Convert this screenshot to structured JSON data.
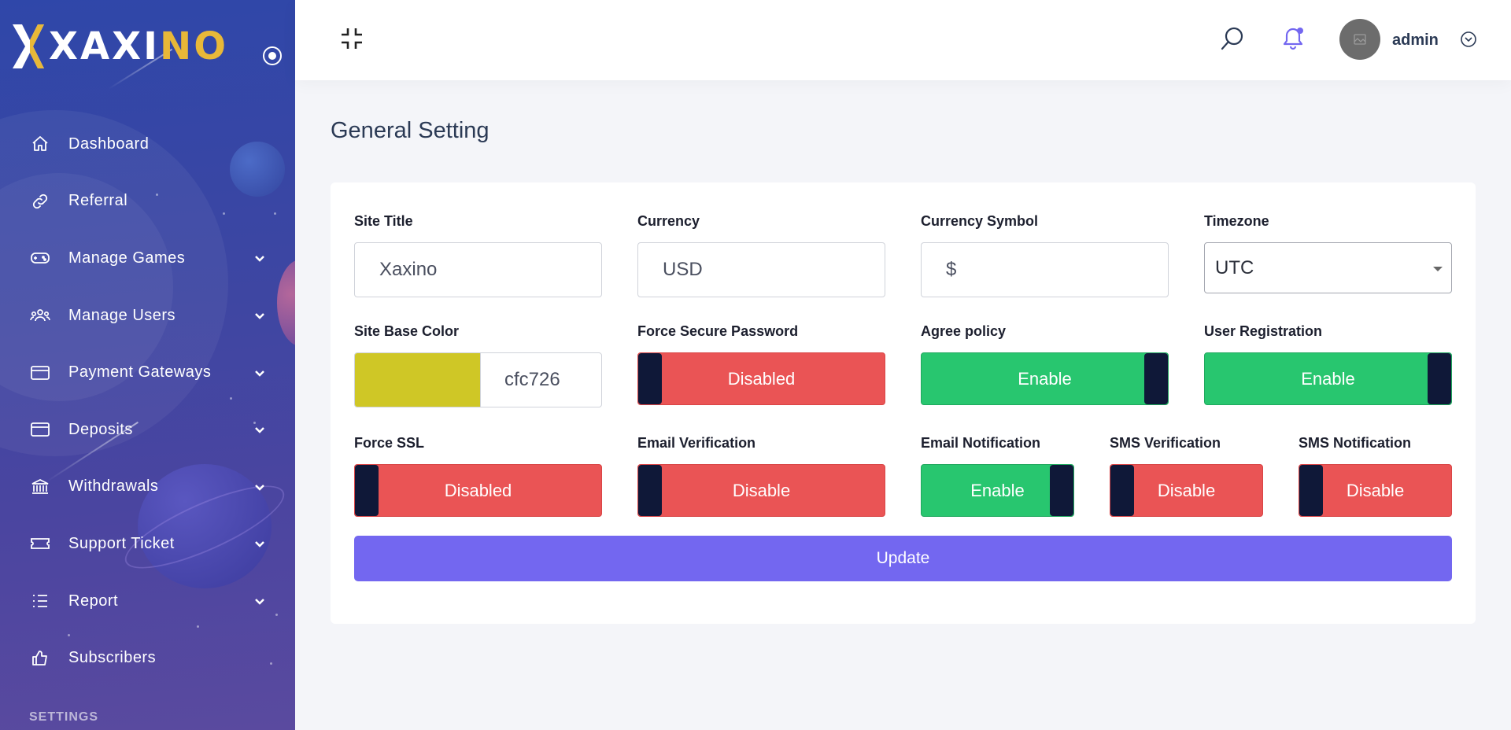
{
  "brand": {
    "name_main": "XAXI",
    "name_accent": "NO"
  },
  "sidebar": {
    "items": [
      {
        "label": "Dashboard",
        "icon": "home-icon",
        "has_submenu": false
      },
      {
        "label": "Referral",
        "icon": "link-icon",
        "has_submenu": false
      },
      {
        "label": "Manage Games",
        "icon": "gamepad-icon",
        "has_submenu": true
      },
      {
        "label": "Manage Users",
        "icon": "users-icon",
        "has_submenu": true
      },
      {
        "label": "Payment Gateways",
        "icon": "credit-card-icon",
        "has_submenu": true
      },
      {
        "label": "Deposits",
        "icon": "credit-card-icon",
        "has_submenu": true
      },
      {
        "label": "Withdrawals",
        "icon": "bank-icon",
        "has_submenu": true
      },
      {
        "label": "Support Ticket",
        "icon": "ticket-icon",
        "has_submenu": true
      },
      {
        "label": "Report",
        "icon": "list-icon",
        "has_submenu": true
      },
      {
        "label": "Subscribers",
        "icon": "thumbs-up-icon",
        "has_submenu": false
      }
    ],
    "section_label": "SETTINGS"
  },
  "header": {
    "username": "admin"
  },
  "page": {
    "title": "General Setting"
  },
  "form": {
    "site_title": {
      "label": "Site Title",
      "value": "Xaxino"
    },
    "currency": {
      "label": "Currency",
      "value": "USD"
    },
    "currency_symbol": {
      "label": "Currency Symbol",
      "value": "$"
    },
    "timezone": {
      "label": "Timezone",
      "value": "UTC"
    },
    "site_base_color": {
      "label": "Site Base Color",
      "value": "cfc726",
      "swatch": "#cfc726"
    },
    "force_secure_password": {
      "label": "Force Secure Password",
      "state": "off",
      "text": "Disabled"
    },
    "agree_policy": {
      "label": "Agree policy",
      "state": "on",
      "text": "Enable"
    },
    "user_registration": {
      "label": "User Registration",
      "state": "on",
      "text": "Enable"
    },
    "force_ssl": {
      "label": "Force SSL",
      "state": "off",
      "text": "Disabled"
    },
    "email_verification": {
      "label": "Email Verification",
      "state": "off",
      "text": "Disable"
    },
    "email_notification": {
      "label": "Email Notification",
      "state": "on",
      "text": "Enable"
    },
    "sms_verification": {
      "label": "SMS Verification",
      "state": "off",
      "text": "Disable"
    },
    "sms_notification": {
      "label": "SMS Notification",
      "state": "off",
      "text": "Disable"
    },
    "submit_label": "Update"
  },
  "colors": {
    "accent": "#7367f0",
    "enable": "#28c66f",
    "disable": "#ea5455",
    "knob": "#0f1838",
    "brand_accent": "#e8b838",
    "notification_dot": "#7367f0"
  }
}
